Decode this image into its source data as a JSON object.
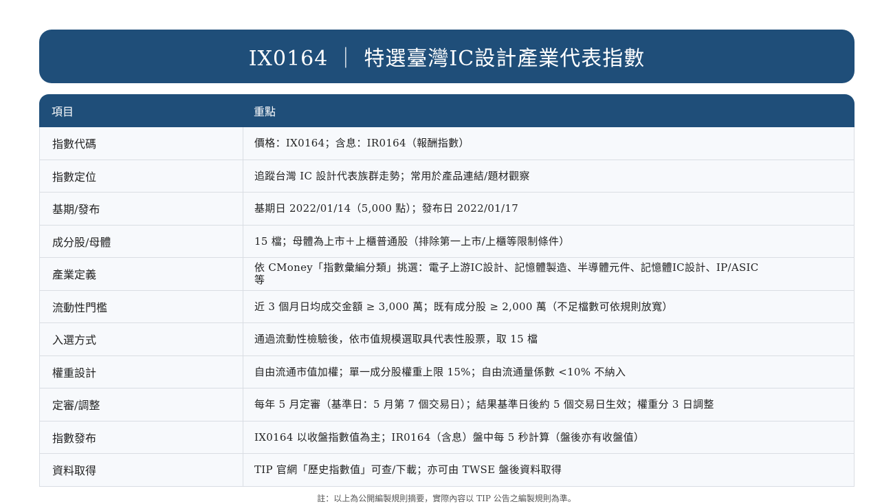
{
  "title": "IX0164 ｜ 特選臺灣IC設計產業代表指數",
  "table": {
    "headers": [
      "項目",
      "重點"
    ],
    "rows": [
      {
        "key": "指數代碼",
        "value": "價格：IX0164；含息：IR0164（報酬指數）"
      },
      {
        "key": "指數定位",
        "value": "追蹤台灣 IC 設計代表族群走勢；常用於產品連結/題材觀察"
      },
      {
        "key": "基期/發布",
        "value": "基期日 2022/01/14（5,000 點）；發布日 2022/01/17"
      },
      {
        "key": "成分股/母體",
        "value": "15 檔；母體為上市＋上櫃普通股（排除第一上市/上櫃等限制條件）"
      },
      {
        "key": "產業定義",
        "value": "依 CMoney「指數彙編分類」挑選：電子上游IC設計、記憶體製造、半導體元件、記憶體IC設計、IP/ASIC 等"
      },
      {
        "key": "流動性門檻",
        "value": "近 3 個月日均成交金額 ≥ 3,000 萬；既有成分股 ≥ 2,000 萬（不足檔數可依規則放寬）"
      },
      {
        "key": "入選方式",
        "value": "通過流動性檢驗後，依市值規模選取具代表性股票，取 15 檔"
      },
      {
        "key": "權重設計",
        "value": "自由流通市值加權；單一成分股權重上限 15%；自由流通量係數 <10% 不納入"
      },
      {
        "key": "定審/調整",
        "value": "每年 5 月定審（基準日：5 月第 7 個交易日）；結果基準日後約 5 個交易日生效；權重分 3 日調整"
      },
      {
        "key": "指數發布",
        "value": "IX0164 以收盤指數值為主；IR0164（含息）盤中每 5 秒計算（盤後亦有收盤值）"
      },
      {
        "key": "資料取得",
        "value": "TIP 官網「歷史指數值」可查/下載；亦可由 TWSE 盤後資料取得"
      }
    ]
  },
  "note": "註：以上為公開編製規則摘要，實際內容以 TIP 公告之編製規則為準。"
}
